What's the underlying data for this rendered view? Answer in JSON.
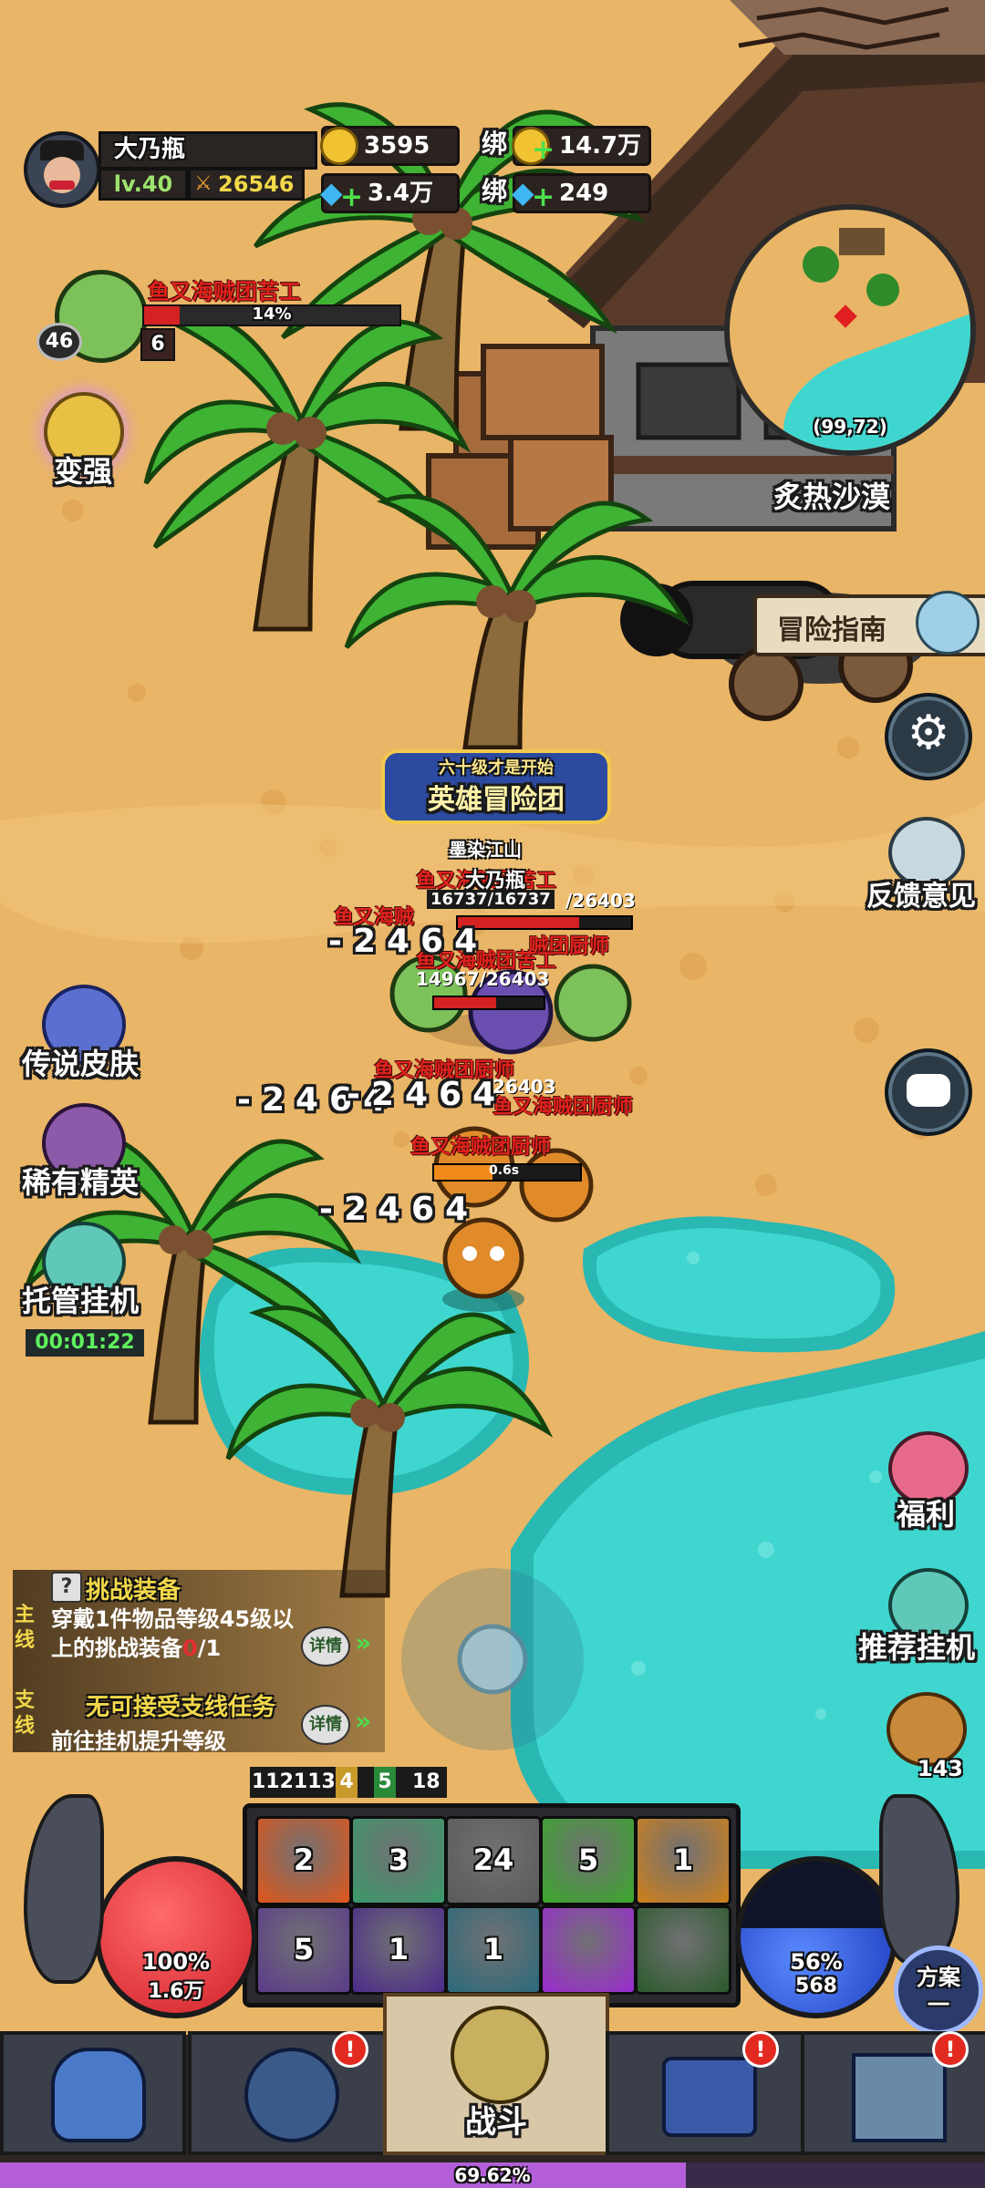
{
  "player": {
    "name": "大乃瓶",
    "level": "lv.40",
    "power": "26546"
  },
  "resources": {
    "gold": "3595",
    "bound_gold_prefix": "绑",
    "bound_gold": "14.7万",
    "diamond": "3.4万",
    "bound_diamond_prefix": "绑",
    "bound_diamond": "249"
  },
  "target": {
    "name": "鱼叉海贼团苦工",
    "hp_percent_text": "14%",
    "level": "46",
    "count": "6",
    "hp_fraction": 0.14
  },
  "minimap": {
    "coords": "(99,72)",
    "region": "炙热沙漠"
  },
  "left_menu": {
    "strengthen": "变强",
    "legend_skin": "传说皮肤",
    "rare_elite": "稀有精英",
    "auto_idle": "托管挂机",
    "auto_idle_timer": "00:01:22"
  },
  "right_menu": {
    "guide": "冒险指南",
    "feedback": "反馈意见",
    "welfare": "福利",
    "recommend_idle": "推荐挂机",
    "bread_count": "143",
    "plan_label": "方案",
    "plan_num": "一"
  },
  "banner": {
    "top": "六十级才是开始",
    "main": "英雄冒险团"
  },
  "battle": {
    "guild_name": "墨染江山",
    "player_name": "大乃瓶",
    "labels": [
      "鱼叉海贼团苦工",
      "鱼叉海贼",
      "贼团厨师",
      "鱼叉海贼团苦工",
      "鱼叉海贼团厨师",
      "鱼叉海贼团厨师",
      "鱼叉海贼团厨师",
      "鱼叉海贼团厨师"
    ],
    "hp_texts": [
      "16737/16737",
      "/26403",
      "14967/26403",
      "26403"
    ],
    "damage_numbers": [
      "-2464",
      "-2464",
      "-2464",
      "-2464"
    ],
    "cast_time": "0.6s"
  },
  "quests": {
    "main_tag": "主线",
    "main_title": "挑战装备",
    "main_desc": "穿戴1件物品等级45级以上的挑战装备",
    "main_progress_current": "0",
    "main_progress_total": "/1",
    "detail": "详情",
    "side_tag": "支线",
    "side_title": "无可接受支线任务",
    "side_desc": "前往挂机提升等级"
  },
  "status_counts": [
    "112113",
    "4",
    "5",
    "18"
  ],
  "skills": {
    "row1": [
      "2",
      "3",
      "24",
      "5",
      "1"
    ],
    "row2": [
      "5",
      "1",
      "1",
      "",
      ""
    ]
  },
  "hp_orb": {
    "percent": "100%",
    "value": "1.6万",
    "fill": 1.0
  },
  "mp_orb": {
    "percent": "56%",
    "value": "568",
    "fill": 0.56
  },
  "bottom_nav": {
    "battle": "战斗",
    "exp_percent": "69.62%",
    "exp_fill": 0.6962
  },
  "colors": {
    "sand": "#e9b566",
    "water": "#2ec7c0",
    "gold_text": "#f2d84a",
    "enemy_name": "#e0221c",
    "exp_bar": "#b45fd9",
    "hp_orb": "#e5303a",
    "mp_orb": "#2f58d9"
  }
}
